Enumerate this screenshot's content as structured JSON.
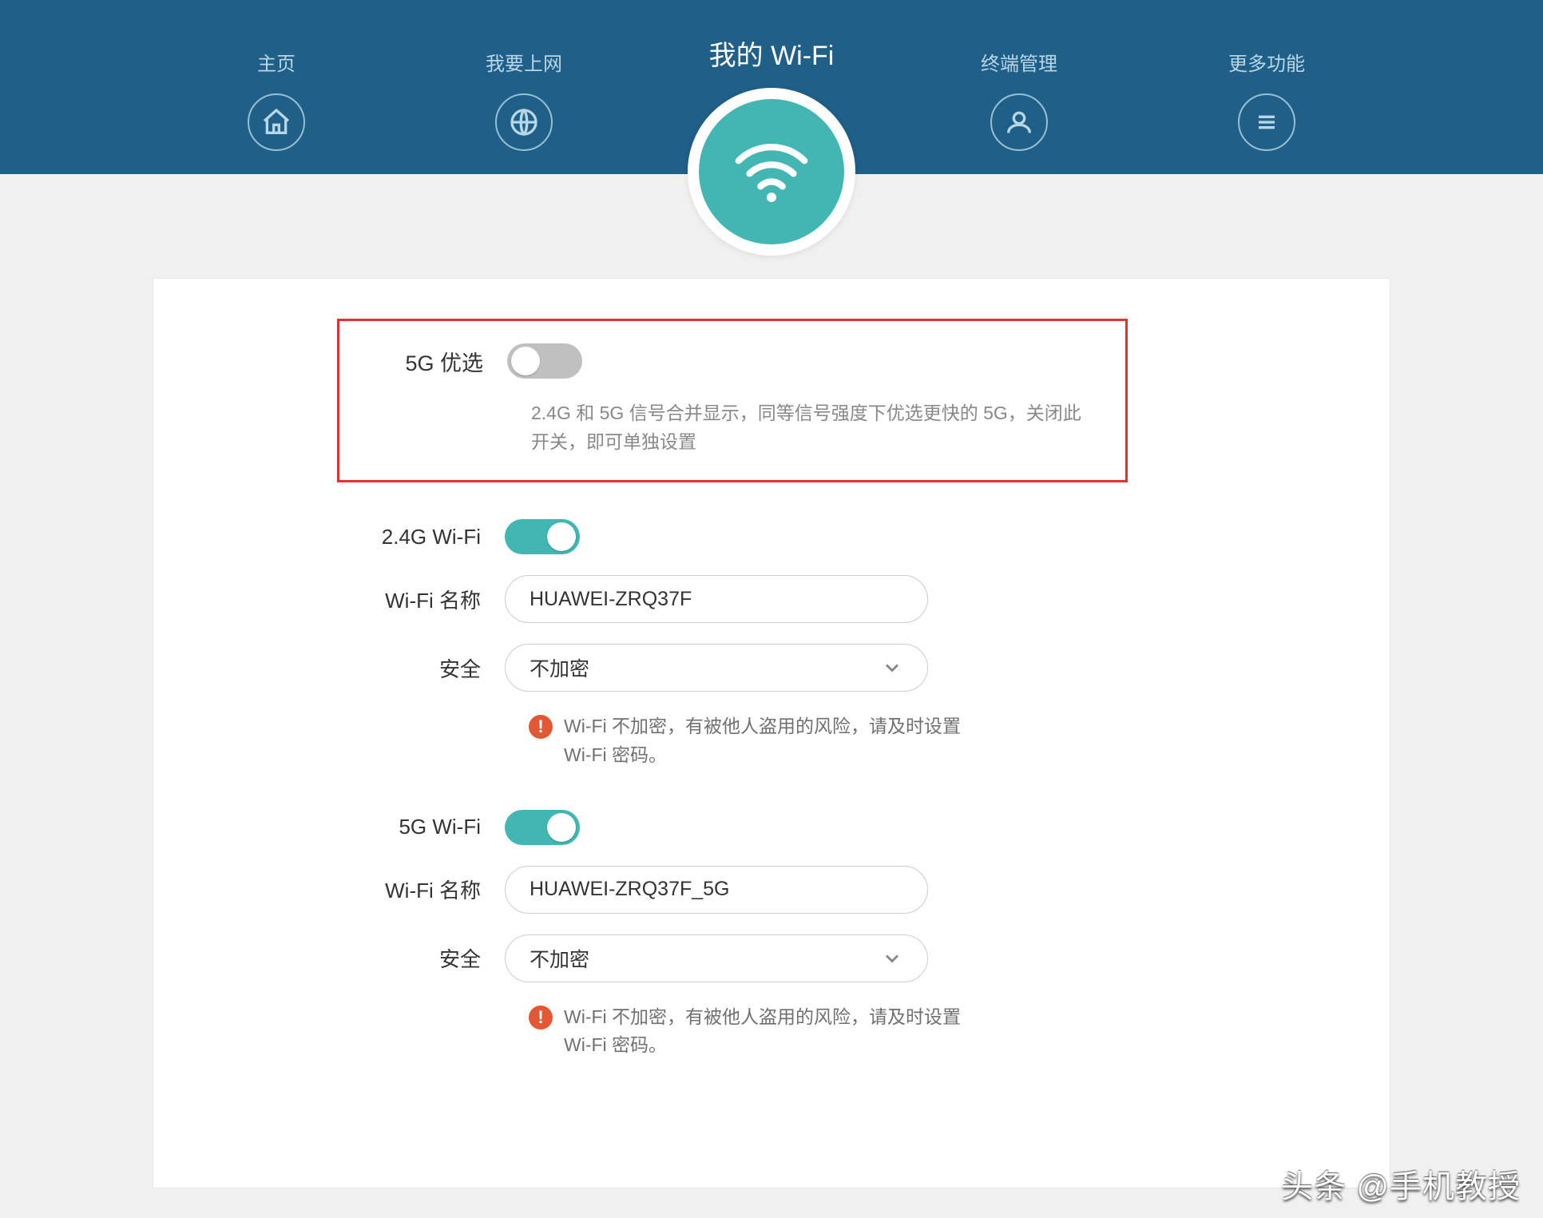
{
  "nav": {
    "home": "主页",
    "internet": "我要上网",
    "wifi": "我的 Wi-Fi",
    "devices": "终端管理",
    "more": "更多功能"
  },
  "section_5g_pref": {
    "label": "5G 优选",
    "desc": "2.4G 和 5G 信号合并显示，同等信号强度下优选更快的 5G，关闭此开关，即可单独设置"
  },
  "wifi24": {
    "toggle_label": "2.4G Wi-Fi",
    "name_label": "Wi-Fi 名称",
    "name_value": "HUAWEI-ZRQ37F",
    "security_label": "安全",
    "security_value": "不加密",
    "warning": "Wi-Fi 不加密，有被他人盗用的风险，请及时设置 Wi-Fi 密码。"
  },
  "wifi5g": {
    "toggle_label": "5G Wi-Fi",
    "name_label": "Wi-Fi 名称",
    "name_value": "HUAWEI-ZRQ37F_5G",
    "security_label": "安全",
    "security_value": "不加密",
    "warning": "Wi-Fi 不加密，有被他人盗用的风险，请及时设置 Wi-Fi 密码。"
  },
  "watermark": "头条 @手机教授"
}
